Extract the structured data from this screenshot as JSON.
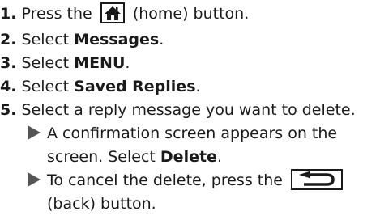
{
  "steps": [
    {
      "number": "1.",
      "before": "Press the",
      "after": "(home) button.",
      "icon": "home-icon"
    },
    {
      "number": "2.",
      "prefix": "Select",
      "bold": "Messages",
      "suffix": "."
    },
    {
      "number": "3.",
      "prefix": "Select",
      "bold": "MENU",
      "suffix": "."
    },
    {
      "number": "4.",
      "prefix": "Select",
      "bold": "Saved Replies",
      "suffix": "."
    },
    {
      "number": "5.",
      "text": "Select a reply message you want to delete."
    }
  ],
  "notes": [
    {
      "line1": "A confirmation screen appears on the",
      "line2_prefix": "screen. Select",
      "line2_bold": "Delete",
      "line2_suffix": "."
    },
    {
      "line1": "To cancel the delete, press the",
      "line2": "(back) button.",
      "icon": "back-icon"
    }
  ]
}
